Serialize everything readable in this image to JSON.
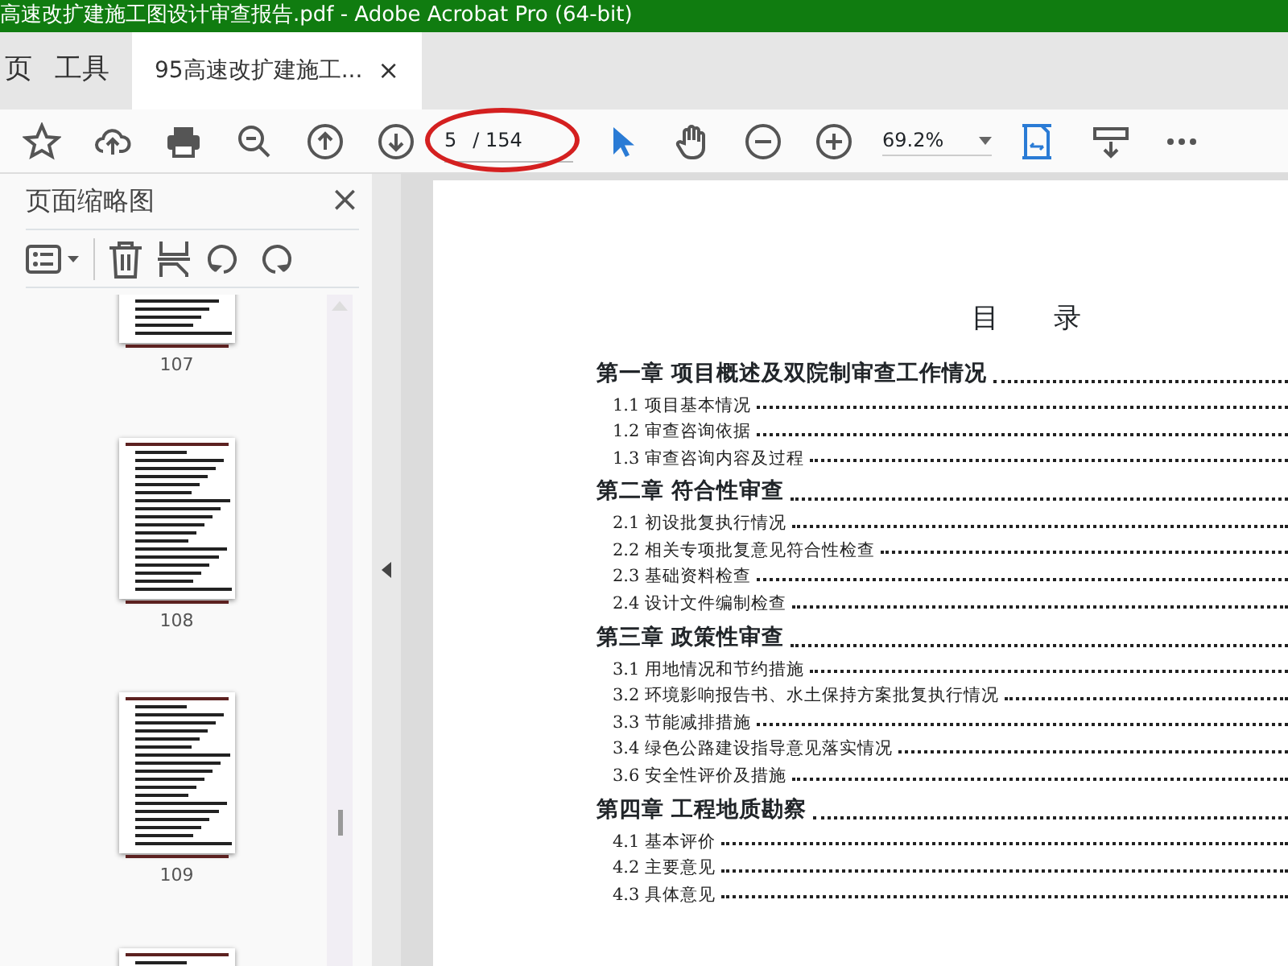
{
  "window": {
    "title": "高速改扩建施工图设计审查报告.pdf - Adobe Acrobat Pro (64-bit)"
  },
  "tabs": [
    {
      "label": "页",
      "selected": false
    },
    {
      "label": "工具",
      "selected": false
    },
    {
      "label": "95高速改扩建施工...",
      "selected": true,
      "close": "×"
    }
  ],
  "toolbar": {
    "page_value": "5",
    "page_total": "/ 154",
    "zoom": "69.2%"
  },
  "panel": {
    "title": "页面缩略图",
    "close": "×",
    "thumbnails": [
      {
        "label": "107"
      },
      {
        "label": "108"
      },
      {
        "label": "109"
      }
    ]
  },
  "document": {
    "heading": "目　　录",
    "toc": [
      {
        "kind": "chapter",
        "text": "第一章 项目概述及双院制审查工作情况"
      },
      {
        "kind": "section",
        "text": "1.1 项目基本情况"
      },
      {
        "kind": "section",
        "text": "1.2 审查咨询依据"
      },
      {
        "kind": "section",
        "text": "1.3 审查咨询内容及过程"
      },
      {
        "kind": "chapter",
        "text": "第二章 符合性审查"
      },
      {
        "kind": "section",
        "text": "2.1 初设批复执行情况"
      },
      {
        "kind": "section",
        "text": "2.2 相关专项批复意见符合性检查"
      },
      {
        "kind": "section",
        "text": "2.3 基础资料检查"
      },
      {
        "kind": "section",
        "text": "2.4 设计文件编制检查"
      },
      {
        "kind": "chapter",
        "text": "第三章 政策性审查"
      },
      {
        "kind": "section",
        "text": "3.1 用地情况和节约措施"
      },
      {
        "kind": "section",
        "text": "3.2 环境影响报告书、水土保持方案批复执行情况"
      },
      {
        "kind": "section",
        "text": "3.3 节能减排措施"
      },
      {
        "kind": "section",
        "text": "3.4 绿色公路建设指导意见落实情况"
      },
      {
        "kind": "section",
        "text": "3.6 安全性评价及措施"
      },
      {
        "kind": "chapter",
        "text": "第四章 工程地质勘察"
      },
      {
        "kind": "section",
        "text": "4.1 基本评价"
      },
      {
        "kind": "section",
        "text": "4.2 主要意见"
      },
      {
        "kind": "section",
        "text": "4.3 具体意见"
      }
    ]
  }
}
